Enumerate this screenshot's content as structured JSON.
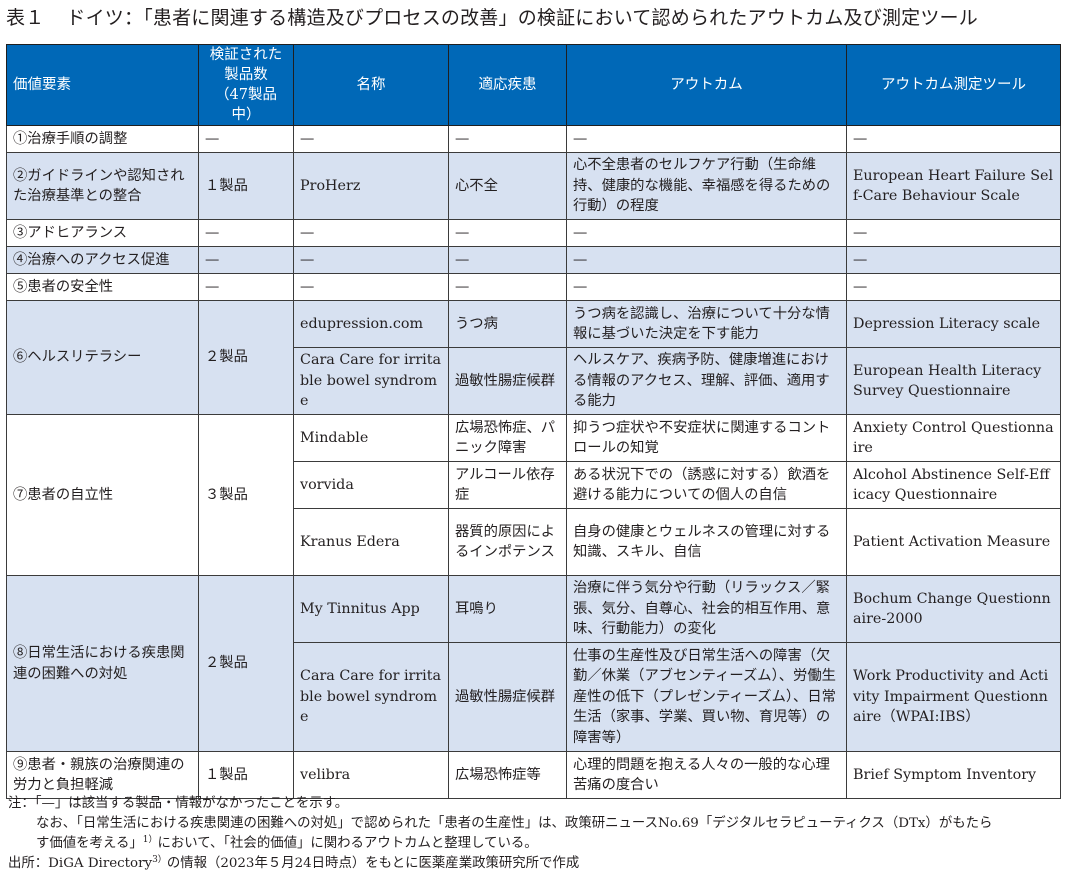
{
  "title": {
    "number": "表１",
    "text": "ドイツ：「患者に関連する構造及びプロセスの改善」の検証において認められたアウトカム及び測定ツール"
  },
  "table": {
    "headers": [
      {
        "label": "価値要素"
      },
      {
        "label_lines": [
          "検証された",
          "製品数",
          "（47製品中）"
        ]
      },
      {
        "label": "名称"
      },
      {
        "label": "適応疾患"
      },
      {
        "label": "アウトカム"
      },
      {
        "label": "アウトカム測定ツール"
      }
    ],
    "groups": [
      {
        "element": "①治療手順の調整",
        "count": "—",
        "rows": [
          {
            "name": "—",
            "disease": "—",
            "outcome": "—",
            "tool": "—"
          }
        ]
      },
      {
        "element": "②ガイドラインや認知された治療基準との整合",
        "count": "１製品",
        "rows": [
          {
            "name": "ProHerz",
            "disease": "心不全",
            "outcome": "心不全患者のセルフケア行動（生命維持、健康的な機能、幸福感を得るための行動）の程度",
            "tool": "European Heart Failure Self-Care Behaviour Scale"
          }
        ]
      },
      {
        "element": "③アドヒアランス",
        "count": "—",
        "rows": [
          {
            "name": "—",
            "disease": "—",
            "outcome": "—",
            "tool": "—"
          }
        ]
      },
      {
        "element": "④治療へのアクセス促進",
        "count": "—",
        "rows": [
          {
            "name": "—",
            "disease": "—",
            "outcome": "—",
            "tool": "—"
          }
        ]
      },
      {
        "element": "⑤患者の安全性",
        "count": "—",
        "rows": [
          {
            "name": "—",
            "disease": "—",
            "outcome": "—",
            "tool": "—"
          }
        ]
      },
      {
        "element": "⑥ヘルスリテラシー",
        "count": "２製品",
        "rows": [
          {
            "name": "edupression.com",
            "disease": "うつ病",
            "outcome": "うつ病を認識し、治療について十分な情報に基づいた決定を下す能力",
            "tool": "Depression Literacy scale"
          },
          {
            "name": "Cara Care for irritable bowel syndrome",
            "disease": "過敏性腸症候群",
            "outcome": "ヘルスケア、疾病予防、健康増進における情報のアクセス、理解、評価、適用する能力",
            "tool": "European Health Literacy Survey Questionnaire"
          }
        ]
      },
      {
        "element": "⑦患者の自立性",
        "count": "３製品",
        "rows": [
          {
            "name": "Mindable",
            "disease": "広場恐怖症、パニック障害",
            "outcome": "抑うつ症状や不安症状に関連するコントロールの知覚",
            "tool": "Anxiety Control Questionnaire"
          },
          {
            "name": "vorvida",
            "disease": "アルコール依存症",
            "outcome": "ある状況下での（誘惑に対する）飲酒を避ける能力についての個人の自信",
            "tool": "Alcohol Abstinence Self-Efficacy Questionnaire"
          },
          {
            "name": "Kranus Edera",
            "disease": "器質的原因によるインポテンス",
            "outcome": "自身の健康とウェルネスの管理に対する知識、スキル、自信",
            "tool": "Patient Activation Measure"
          }
        ]
      },
      {
        "element": "⑧日常生活における疾患関連の困難への対処",
        "count": "２製品",
        "rows": [
          {
            "name": "My Tinnitus App",
            "disease": "耳鳴り",
            "outcome": "治療に伴う気分や行動（リラックス／緊張、気分、自尊心、社会的相互作用、意味、行動能力）の変化",
            "tool": "Bochum Change Questionnaire-2000"
          },
          {
            "name": "Cara Care for irritable bowel syndrome",
            "disease": "過敏性腸症候群",
            "outcome": "仕事の生産性及び日常生活への障害（欠勤／休業（アブセンティーズム）、労働生産性の低下（プレゼンティーズム）、日常生活（家事、学業、買い物、育児等）の障害等）",
            "tool": "Work Productivity and Activity Impairment Questionnaire（WPAI:IBS）"
          }
        ]
      },
      {
        "element": "⑨患者・親族の治療関連の労力と負担軽減",
        "count": "１製品",
        "rows": [
          {
            "name": "velibra",
            "disease": "広場恐怖症等",
            "outcome": "心理的問題を抱える人々の一般的な心理苦痛の度合い",
            "tool": "Brief Symptom Inventory"
          }
        ]
      }
    ]
  },
  "notes": {
    "note_line1": "注：「—」は該当する製品・情報がなかったことを示す。",
    "note_line2": "なお、「日常生活における疾患関連の困難への対処」で認められた「患者の生産性」は、政策研ニュースNo.69「デジタルセラピューティクス（DTx）がもたら",
    "note_line3a": "す価値を考える」",
    "note_line3_sup": "1）",
    "note_line3b": "において、「社会的価値」に関わるアウトカムと整理している。",
    "source_a": "出所：DiGA Directory",
    "source_sup": "3）",
    "source_b": "の情報（2023年５月24日時点）をもとに医薬産業政策研究所で作成"
  }
}
